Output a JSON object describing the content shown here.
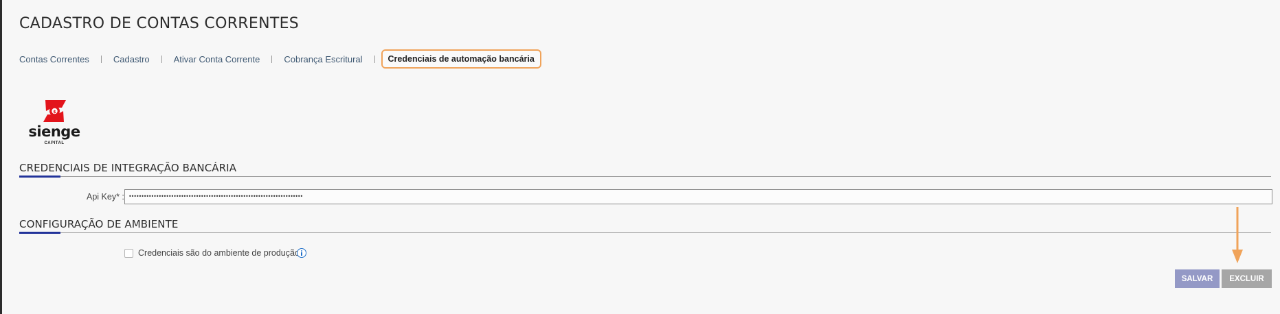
{
  "page": {
    "title": "CADASTRO DE CONTAS CORRENTES"
  },
  "tabs": [
    {
      "label": "Contas Correntes",
      "active": false
    },
    {
      "label": "Cadastro",
      "active": false
    },
    {
      "label": "Ativar Conta Corrente",
      "active": false
    },
    {
      "label": "Cobrança Escritural",
      "active": false
    },
    {
      "label": "Credenciais de automação bancária",
      "active": true
    }
  ],
  "logo": {
    "icon": "sienge-capital-logo",
    "name": "sienge",
    "sub": "CAPITAL",
    "color": "#e3141b"
  },
  "sections": {
    "credentials": {
      "title": "CREDENCIAIS DE INTEGRAÇÃO BANCÁRIA"
    },
    "environment": {
      "title": "CONFIGURAÇÃO DE AMBIENTE"
    }
  },
  "form": {
    "api_key_label": "Api Key* :",
    "api_key_value": "••••••••••••••••••••••••••••••••••••••••••••••••••••••••••••••••••••••",
    "production_checkbox_label": "Credenciais são do ambiente de produção",
    "production_checked": false,
    "info_icon": "info-icon"
  },
  "actions": {
    "save_label": "SALVAR",
    "delete_label": "EXCLUIR"
  },
  "annotation": {
    "icon": "arrow-down-icon",
    "color": "#f0a35a"
  },
  "colors": {
    "accent": "#22339a",
    "tab_highlight": "#f0a35a",
    "link": "#3e5872"
  }
}
